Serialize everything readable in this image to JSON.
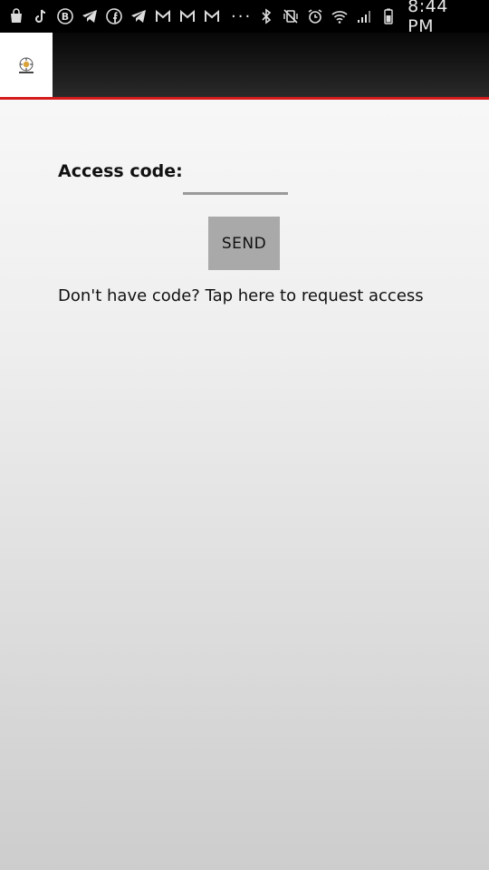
{
  "status_bar": {
    "time": "8:44 PM",
    "more_indicator": "···",
    "left_icons": [
      "shopping-bag-icon",
      "tiktok-icon",
      "b-circle-icon",
      "telegram-icon",
      "facebook-icon",
      "telegram-icon",
      "gmail-icon",
      "gmail-icon",
      "gmail-icon"
    ],
    "right_icons": [
      "bluetooth-icon",
      "vibrate-mute-icon",
      "alarm-icon",
      "wifi-icon",
      "signal-icon",
      "battery-icon"
    ]
  },
  "app_bar": {
    "logo": "app-logo-icon",
    "accent_color": "#d51b1b"
  },
  "form": {
    "access_label": "Access code:",
    "access_value": "",
    "send_label": "SEND",
    "request_link": "Don't have code? Tap here to request access"
  }
}
